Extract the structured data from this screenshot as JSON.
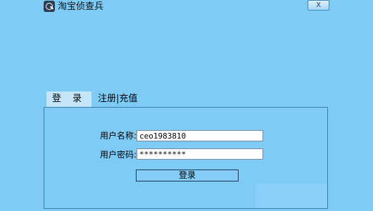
{
  "window": {
    "title": "淘宝侦查兵",
    "close_label": "X",
    "icon": "magnifier-app-icon"
  },
  "tabs": [
    {
      "label": "登 录",
      "active": true
    },
    {
      "label": "注册|充值",
      "active": false
    }
  ],
  "form": {
    "username_label": "用户名称:",
    "username_value": "ceo1983810",
    "password_label": "用户密码:",
    "password_value": "**********",
    "login_button": "登录"
  },
  "colors": {
    "background": "#7ecbf6",
    "active_tab": "#c5e6fa",
    "panel_border": "#3d7ea6"
  }
}
